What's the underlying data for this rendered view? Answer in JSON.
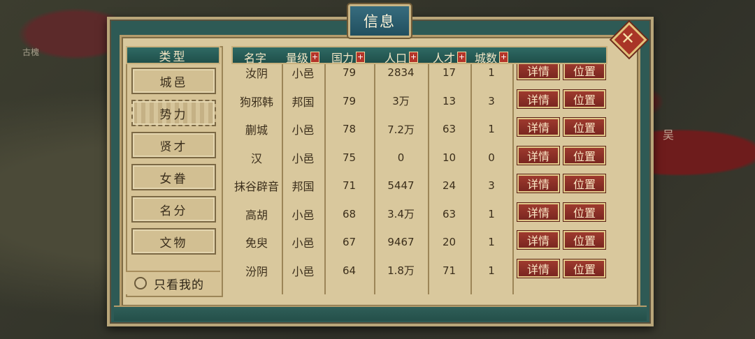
{
  "title": "信息",
  "close_symbol": "✕",
  "map_labels": {
    "east": "吴",
    "west": "古槐"
  },
  "categories": {
    "header": "类型",
    "items": [
      "城邑",
      "势力",
      "贤才",
      "女眷",
      "名分",
      "文物"
    ],
    "active": "势力"
  },
  "only_mine_label": "只看我的",
  "table": {
    "headers": {
      "name": "名字",
      "level": "量级",
      "power": "国力",
      "population": "人口",
      "talent": "人才",
      "cities": "城数"
    },
    "sort_icon": "+",
    "rows": [
      {
        "name": "汝阴",
        "level": "小邑",
        "power": "79",
        "population": "2834",
        "talent": "17",
        "cities": "1"
      },
      {
        "name": "狗邪韩",
        "level": "邦国",
        "power": "79",
        "population": "3万",
        "talent": "13",
        "cities": "3"
      },
      {
        "name": "蒯城",
        "level": "小邑",
        "power": "78",
        "population": "7.2万",
        "talent": "63",
        "cities": "1"
      },
      {
        "name": "汉",
        "level": "小邑",
        "power": "75",
        "population": "0",
        "talent": "10",
        "cities": "0"
      },
      {
        "name": "抹谷辟音",
        "level": "邦国",
        "power": "71",
        "population": "5447",
        "talent": "24",
        "cities": "3"
      },
      {
        "name": "高胡",
        "level": "小邑",
        "power": "68",
        "population": "3.4万",
        "talent": "63",
        "cities": "1"
      },
      {
        "name": "免臾",
        "level": "小邑",
        "power": "67",
        "population": "9467",
        "talent": "20",
        "cities": "1"
      },
      {
        "name": "汾阴",
        "level": "小邑",
        "power": "64",
        "population": "1.8万",
        "talent": "71",
        "cities": "1"
      }
    ],
    "details_label": "详情",
    "locate_label": "位置"
  },
  "colors": {
    "panel": "#2e5a55",
    "parchment": "#d9c89d",
    "button": "#9e3a2e"
  }
}
